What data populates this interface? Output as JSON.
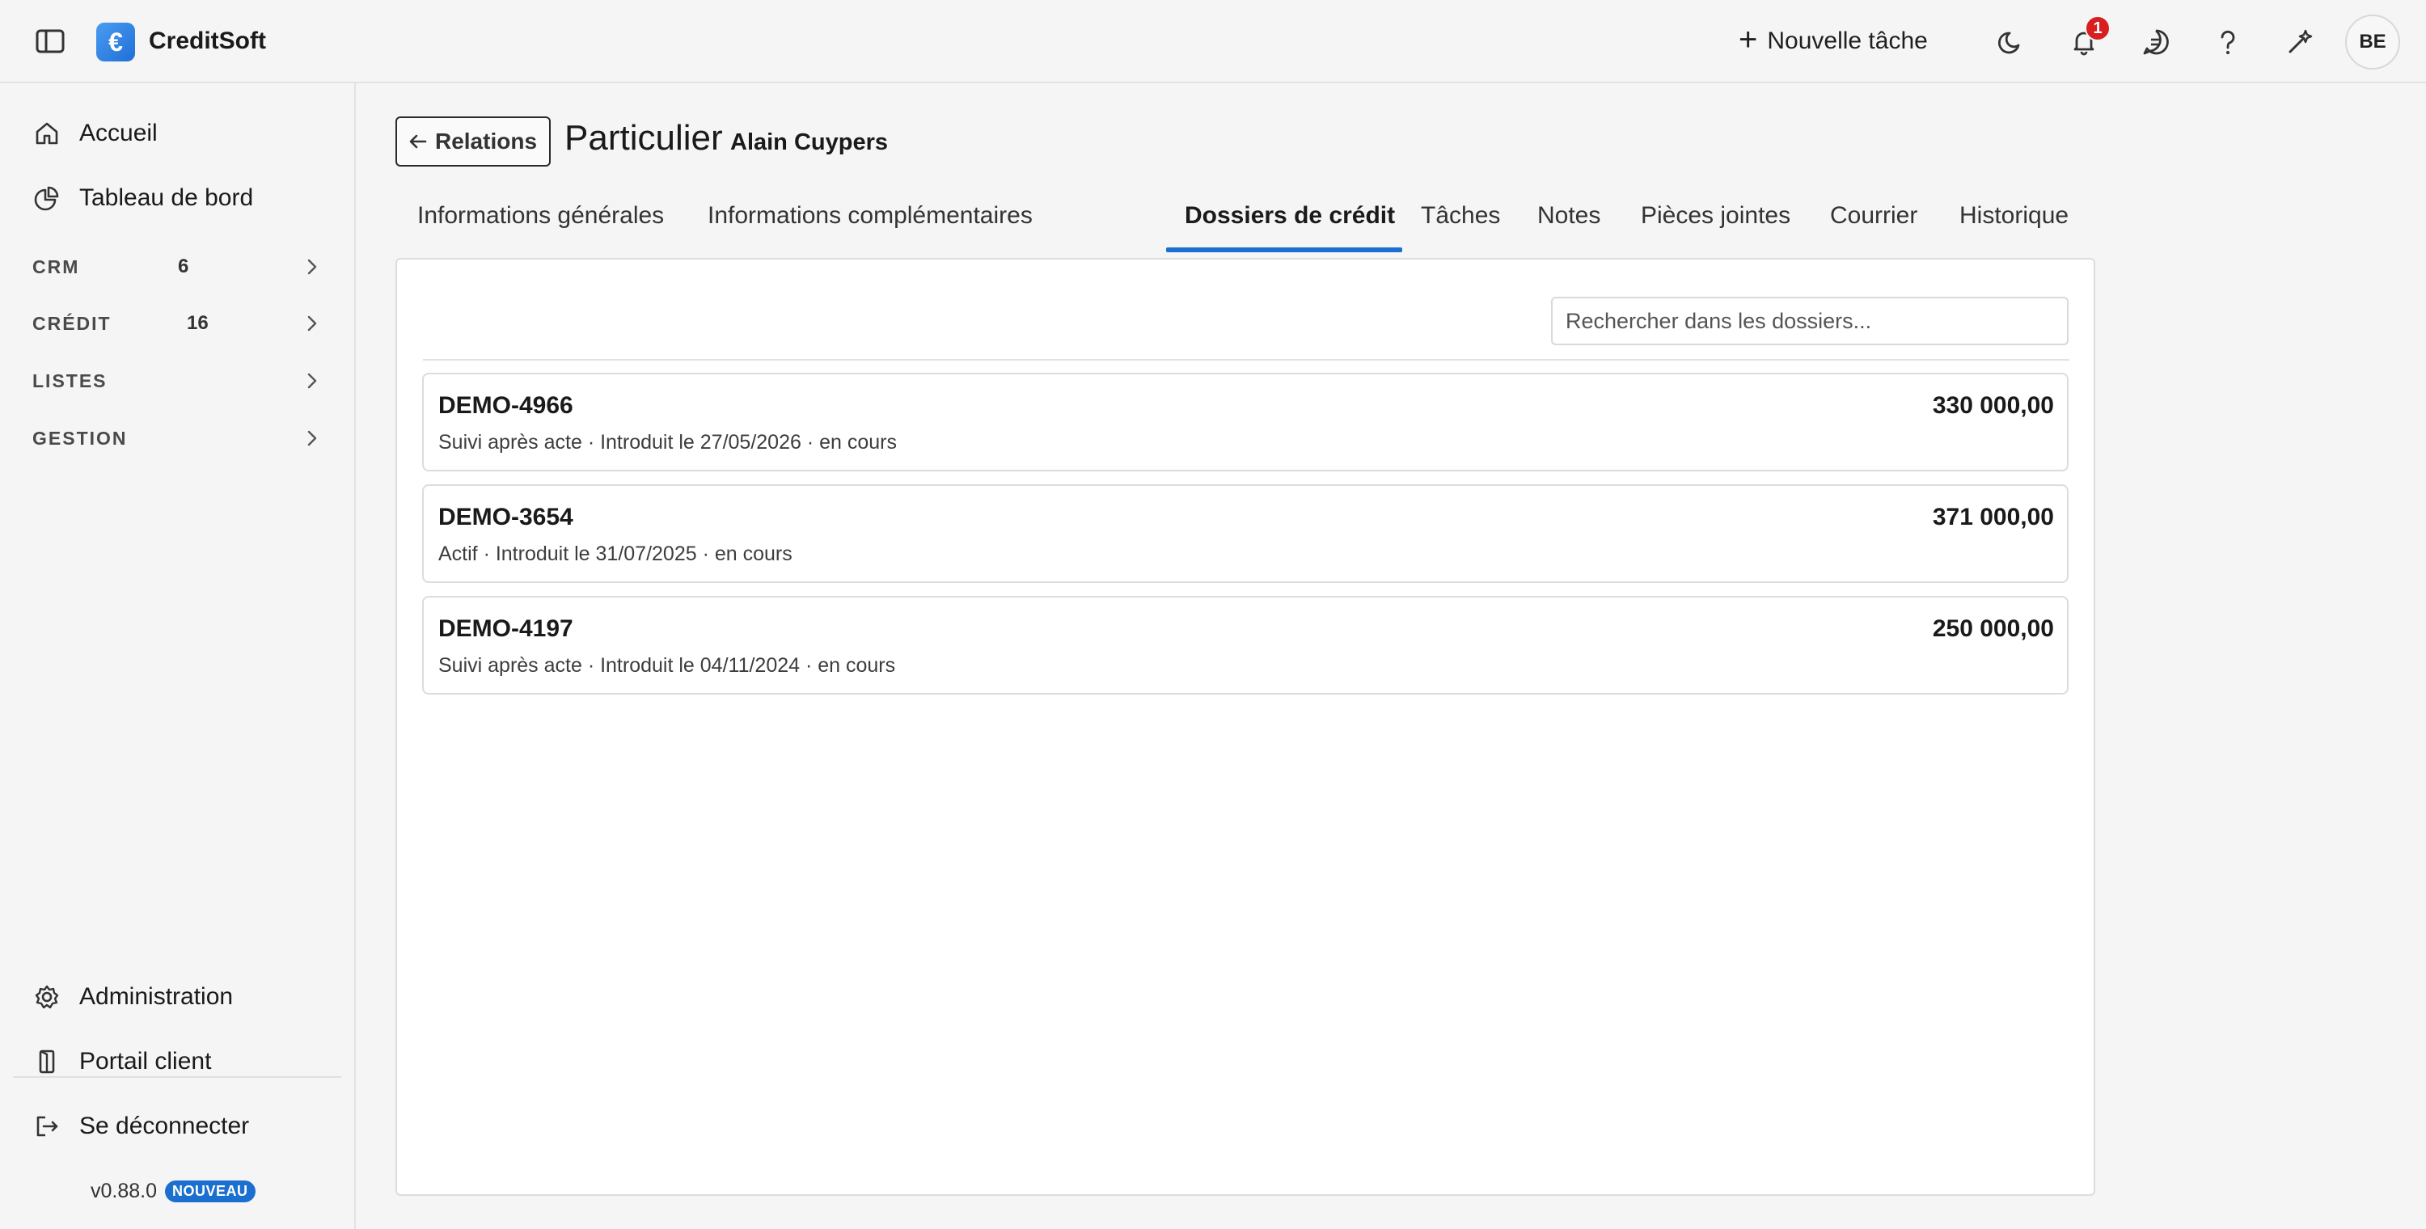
{
  "app": {
    "brand": "CreditSoft",
    "logo_glyph": "€"
  },
  "header": {
    "new_task_label": "Nouvelle tâche",
    "notification_count": "1",
    "avatar_initials": "BE",
    "icons": [
      "sidebar-toggle-icon",
      "moon-icon",
      "bell-icon",
      "chat-icon",
      "help-icon",
      "sparkle-icon"
    ]
  },
  "sidebar": {
    "top_items": [
      {
        "label": "Accueil",
        "icon": "home-icon"
      },
      {
        "label": "Tableau de bord",
        "icon": "pie-chart-icon"
      }
    ],
    "sections": [
      {
        "label": "CRM",
        "count": "6"
      },
      {
        "label": "CRÉDIT",
        "count": "16"
      },
      {
        "label": "LISTES",
        "count": ""
      },
      {
        "label": "GESTION",
        "count": ""
      }
    ],
    "bottom_items": [
      {
        "label": "Administration",
        "icon": "gear-icon"
      },
      {
        "label": "Portail client",
        "icon": "door-icon"
      },
      {
        "label": "Se déconnecter",
        "icon": "logout-icon"
      }
    ],
    "version": "v0.88.0",
    "version_badge": "NOUVEAU"
  },
  "page": {
    "back_label": "Relations",
    "title": "Particulier",
    "subtitle": "Alain Cuypers",
    "tabs": [
      {
        "label": "Informations générales",
        "active": false
      },
      {
        "label": "Informations complémentaires",
        "active": false
      },
      {
        "label": "Dossiers de crédit",
        "active": true
      },
      {
        "label": "Tâches",
        "active": false
      },
      {
        "label": "Notes",
        "active": false
      },
      {
        "label": "Pièces jointes",
        "active": false
      },
      {
        "label": "Courrier",
        "active": false
      },
      {
        "label": "Historique",
        "active": false
      }
    ],
    "search_placeholder": "Rechercher dans les dossiers...",
    "dossiers": [
      {
        "ref": "DEMO-4966",
        "meta": "Suivi après acte · Introduit le 27/05/2026 · en cours",
        "amount": "330 000,00"
      },
      {
        "ref": "DEMO-3654",
        "meta": "Actif · Introduit le 31/07/2025 · en cours",
        "amount": "371 000,00"
      },
      {
        "ref": "DEMO-4197",
        "meta": "Suivi après acte · Introduit le 04/11/2024 · en cours",
        "amount": "250 000,00"
      }
    ]
  },
  "colors": {
    "accent": "#1a6fcf",
    "badge": "#d81e1e",
    "logo": "#2b7fe0"
  }
}
